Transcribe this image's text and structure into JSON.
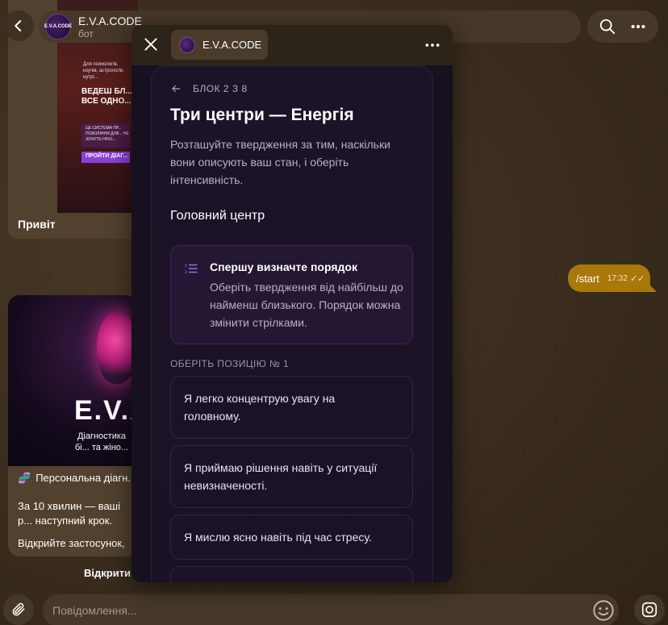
{
  "header": {
    "title": "E.V.A.CODE",
    "subtitle": "бот",
    "avatar_text": "E.V.A.CODE"
  },
  "chat": {
    "promo": {
      "line1": "Для психологів, коучів, астрологів, нутрі...",
      "line2": "ВЕДЕШ БЛ... ВСЕ ОДНО...",
      "band": "ЦЕ СИСТЕМА ПР... ПОКОЛІННЯ ДЛЯ... НЕ ХОЧУТЬ НІЧО...",
      "button": "ПРОЙТИ ДІАГ..."
    },
    "hi_text": "Привіт",
    "start_command": "/start",
    "start_time": "17:32",
    "start_ticks": "✓✓",
    "eva_card": {
      "title": "E.V.A",
      "subtitle": "Діагностика бі... та жіно...",
      "diag_line": "Персональна діагн...",
      "dna_icon": "🧬",
      "para1": "За 10 хвилин — ваші р... наступний крок.",
      "para2": "Відкрийте застосунок,",
      "open_button": "Відкрити"
    }
  },
  "composer": {
    "placeholder": "Повідомлення..."
  },
  "miniapp": {
    "chip_title": "E.V.A.CODE",
    "breadcrumb": "БЛОК 2 З 8",
    "title": "Три центри — Енергія",
    "lead": "Розташуйте твердження за тим, наскільки вони описують ваш стан, і оберіть інтенсивність.",
    "section": "Головний центр",
    "info": {
      "title": "Спершу визначте порядок",
      "text": "Оберіть твердження від найбільш до найменш близького. Порядок можна змінити стрілками."
    },
    "position_label": "ОБЕРІТЬ ПОЗИЦІЮ № 1",
    "options": [
      "Я легко концентрую увагу на головному.",
      "Я приймаю рішення навіть у ситуації невизначеності.",
      "Я мислю ясно навіть під час стресу."
    ]
  },
  "colors": {
    "chat_bg": "#3a2e20",
    "bubble_out": "#a9780a",
    "app_bg": "#16101f",
    "accent_purple": "#8b3fd9"
  }
}
